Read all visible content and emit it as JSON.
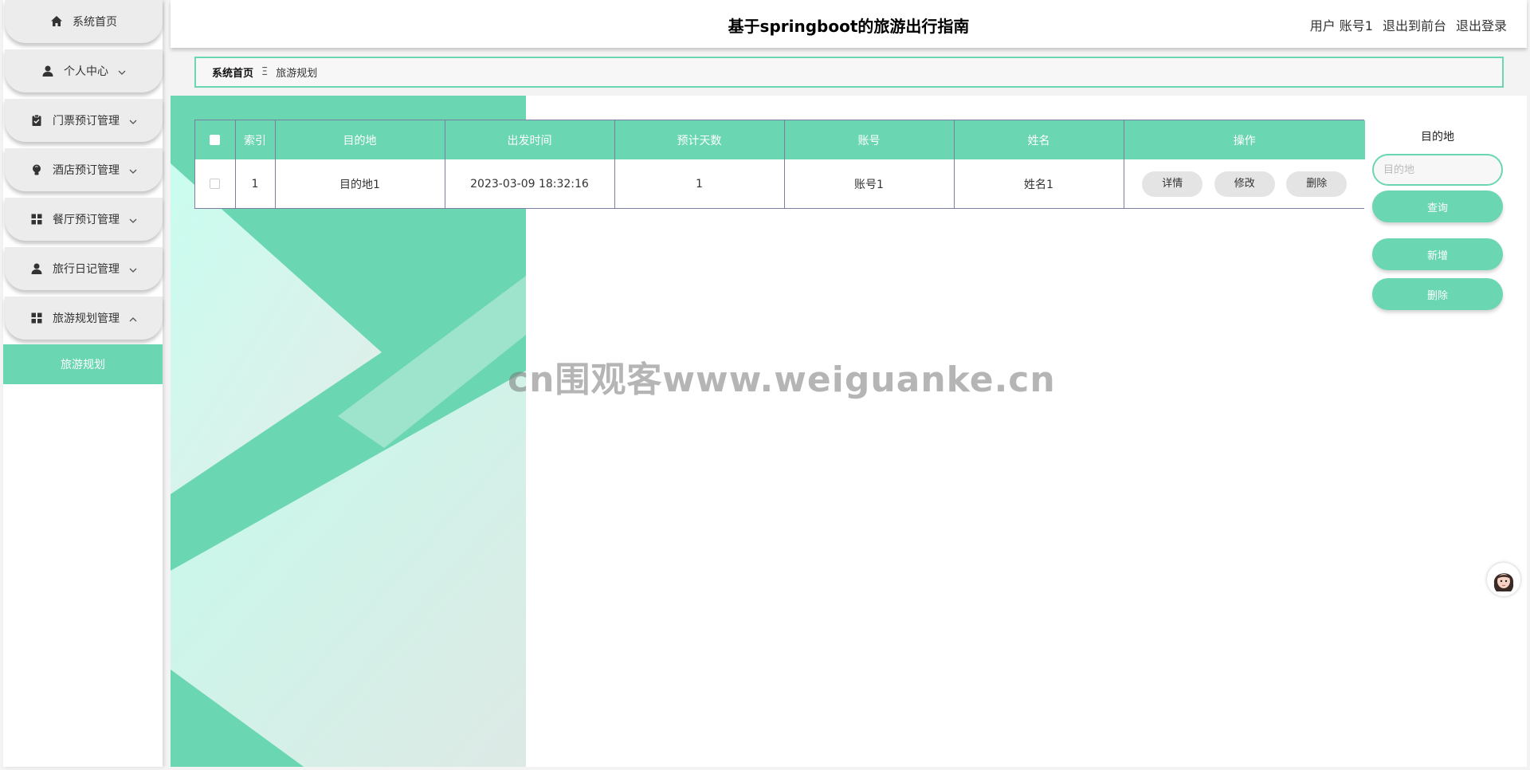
{
  "colors": {
    "accent": "#6ad6b2",
    "menu_bg": "#ececec",
    "table_border": "#7b7ea0"
  },
  "header": {
    "title": "基于springboot的旅游出行指南",
    "user_label": "用户 账号1",
    "to_front": "退出到前台",
    "logout": "退出登录"
  },
  "sidebar": {
    "items": [
      {
        "label": "系统首页",
        "icon": "home-icon"
      },
      {
        "label": "个人中心",
        "icon": "user-icon"
      },
      {
        "label": "门票预订管理",
        "icon": "clipboard-icon"
      },
      {
        "label": "酒店预订管理",
        "icon": "bulb-icon"
      },
      {
        "label": "餐厅预订管理",
        "icon": "grid-icon"
      },
      {
        "label": "旅行日记管理",
        "icon": "user-icon"
      },
      {
        "label": "旅游规划管理",
        "icon": "grid-icon"
      }
    ],
    "sub_active": "旅游规划"
  },
  "breadcrumb": {
    "home": "系统首页",
    "sep": "Ξ",
    "current": "旅游规划"
  },
  "table": {
    "headers": [
      "索引",
      "目的地",
      "出发时间",
      "预计天数",
      "账号",
      "姓名",
      "操作"
    ],
    "rows": [
      {
        "index": "1",
        "dest": "目的地1",
        "time": "2023-03-09 18:32:16",
        "days": "1",
        "account": "账号1",
        "name": "姓名1"
      }
    ],
    "ops": {
      "detail": "详情",
      "edit": "修改",
      "delete": "删除"
    }
  },
  "search": {
    "label": "目的地",
    "placeholder": "目的地",
    "query": "查询",
    "add": "新增",
    "delete": "删除"
  },
  "watermark": "cn围观客www.weiguanke.cn"
}
